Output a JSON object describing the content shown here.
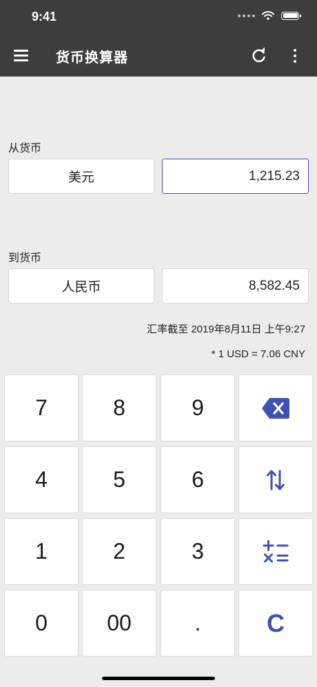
{
  "status_bar": {
    "time": "9:41"
  },
  "toolbar": {
    "title": "货币换算器"
  },
  "from": {
    "label": "从货币",
    "currency": "美元",
    "amount": "1,215.23"
  },
  "to": {
    "label": "到货币",
    "currency": "人民币",
    "amount": "8,582.45"
  },
  "rate": {
    "updated": "汇率截至 2019年8月11日 上午9:27",
    "equation": "* 1 USD = 7.06 CNY"
  },
  "keypad": {
    "k7": "7",
    "k8": "8",
    "k9": "9",
    "k4": "4",
    "k5": "5",
    "k6": "6",
    "k1": "1",
    "k2": "2",
    "k3": "3",
    "k0": "0",
    "k00": "00",
    "kdot": ".",
    "clear": "C"
  },
  "colors": {
    "accent": "#3f51b5",
    "header": "#3d3d3d",
    "background": "#ececec"
  },
  "icons": [
    "menu-icon",
    "refresh-icon",
    "more-vert-icon",
    "backspace-icon",
    "swap-icon",
    "operators-icon"
  ]
}
